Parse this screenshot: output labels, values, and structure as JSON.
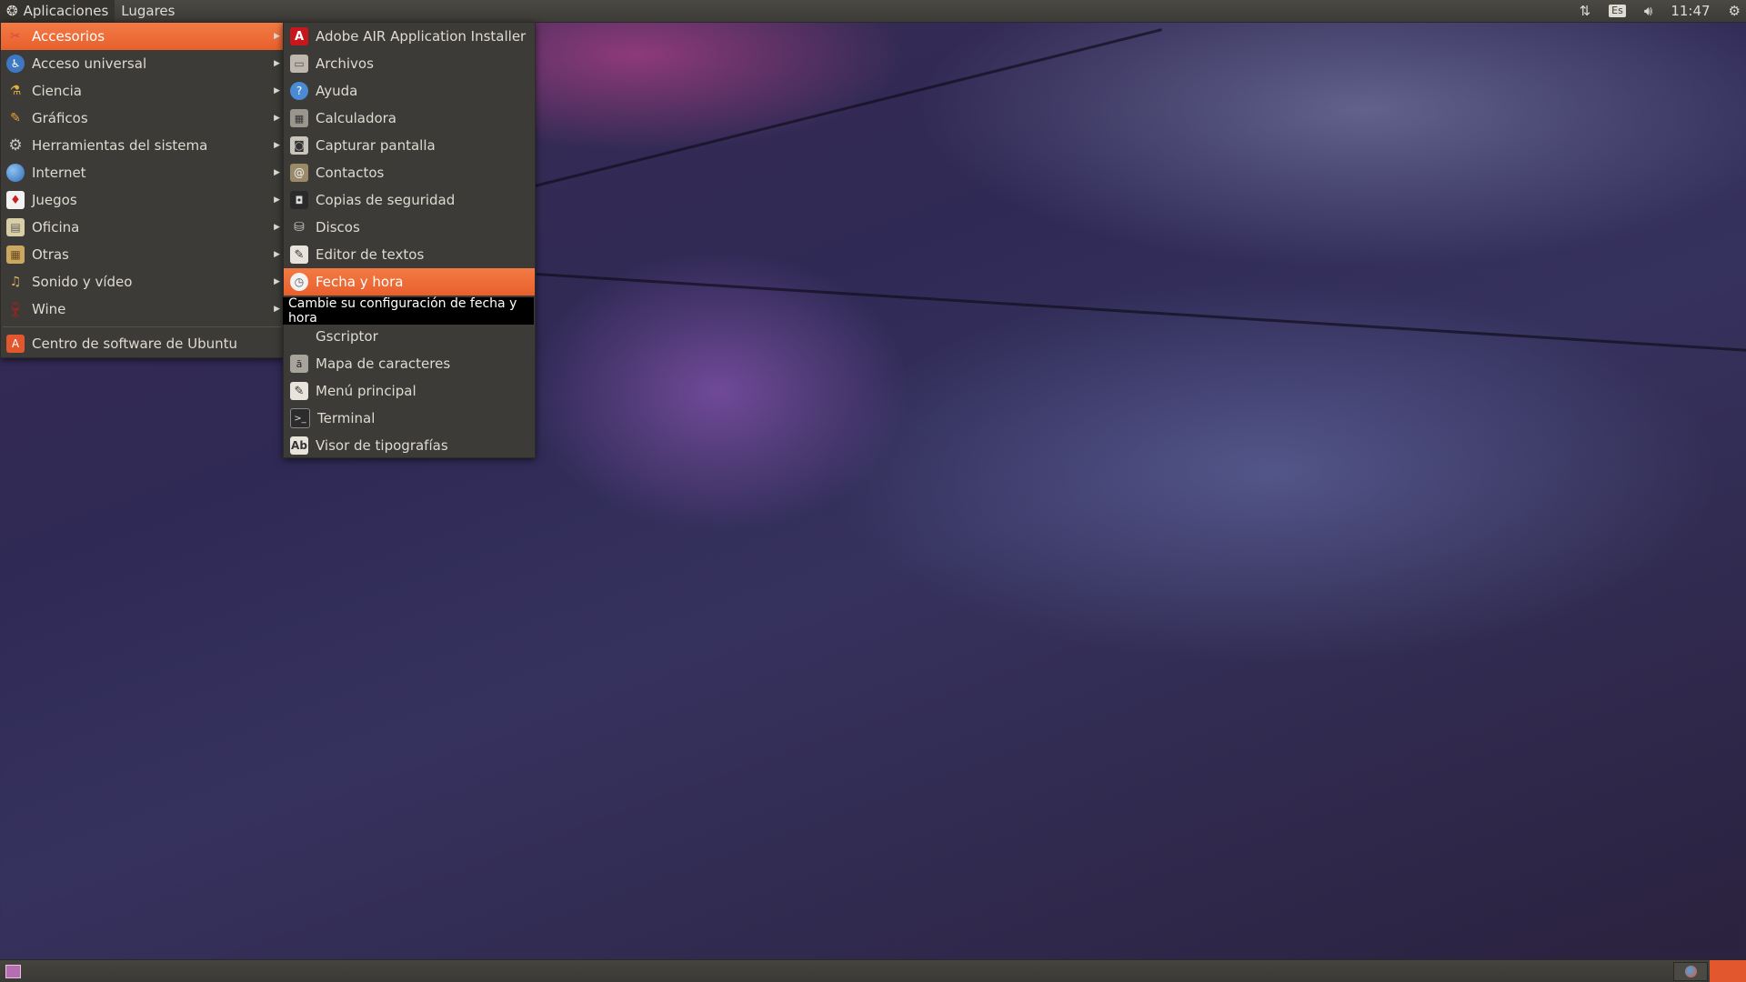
{
  "top_panel": {
    "apps_label": "Aplicaciones",
    "places_label": "Lugares",
    "keyboard_layout": "Es",
    "clock": "11:47"
  },
  "main_menu": {
    "items": [
      {
        "label": "Accesorios",
        "icon": "accessories-icon",
        "selected": true
      },
      {
        "label": "Acceso universal",
        "icon": "universal-access-icon"
      },
      {
        "label": "Ciencia",
        "icon": "science-icon"
      },
      {
        "label": "Gráficos",
        "icon": "graphics-icon"
      },
      {
        "label": "Herramientas del sistema",
        "icon": "system-tools-icon"
      },
      {
        "label": "Internet",
        "icon": "internet-icon"
      },
      {
        "label": "Juegos",
        "icon": "games-icon"
      },
      {
        "label": "Oficina",
        "icon": "office-icon"
      },
      {
        "label": "Otras",
        "icon": "other-icon"
      },
      {
        "label": "Sonido y vídeo",
        "icon": "sound-video-icon"
      },
      {
        "label": "Wine",
        "icon": "wine-icon"
      }
    ],
    "software_center": "Centro de software de Ubuntu"
  },
  "submenu": {
    "items": [
      {
        "label": "Adobe AIR Application Installer",
        "icon": "adobe-air-icon"
      },
      {
        "label": "Archivos",
        "icon": "files-icon"
      },
      {
        "label": "Ayuda",
        "icon": "help-icon"
      },
      {
        "label": "Calculadora",
        "icon": "calculator-icon"
      },
      {
        "label": "Capturar pantalla",
        "icon": "screenshot-icon"
      },
      {
        "label": "Contactos",
        "icon": "contacts-icon"
      },
      {
        "label": "Copias de seguridad",
        "icon": "backup-icon"
      },
      {
        "label": "Discos",
        "icon": "disks-icon"
      },
      {
        "label": "Editor de textos",
        "icon": "text-editor-icon"
      },
      {
        "label": "Fecha y hora",
        "icon": "clock-icon",
        "selected": true
      },
      {
        "label": "Gscriptor",
        "icon": ""
      },
      {
        "label": "Mapa de caracteres",
        "icon": "character-map-icon"
      },
      {
        "label": "Menú principal",
        "icon": "main-menu-icon"
      },
      {
        "label": "Terminal",
        "icon": "terminal-icon"
      },
      {
        "label": "Visor de tipografías",
        "icon": "font-viewer-icon"
      }
    ],
    "tooltip": "Cambie su configuración de fecha y hora"
  },
  "colors": {
    "panel": "#3c3b37",
    "highlight": "#f07746",
    "text": "#dfdbd2"
  }
}
